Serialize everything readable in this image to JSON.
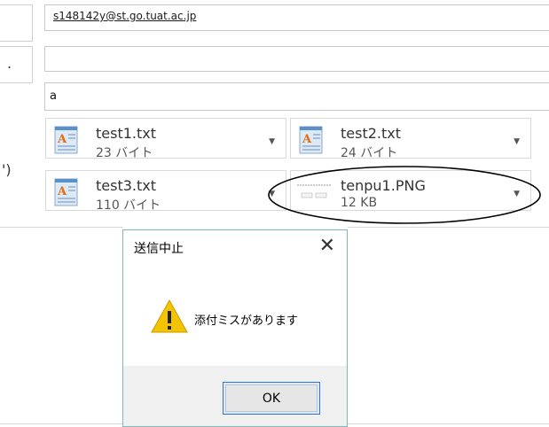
{
  "to_field": {
    "value": "s148142y@st.go.tuat.ac.jp"
  },
  "cc_field": {
    "value": ""
  },
  "subject_field": {
    "value": "a"
  },
  "side_fragments": {
    "row2": ".",
    "row4": "')"
  },
  "attachments": [
    {
      "name": "test1.txt",
      "size": "23 バイト",
      "icon": "text-document-icon"
    },
    {
      "name": "test2.txt",
      "size": "24 バイト",
      "icon": "text-document-icon"
    },
    {
      "name": "test3.txt",
      "size": "110 バイト",
      "icon": "text-document-icon"
    },
    {
      "name": "tenpu1.PNG",
      "size": "12 KB",
      "icon": "image-thumbnail-icon"
    }
  ],
  "dialog": {
    "title": "送信中止",
    "message": "添付ミスがあります",
    "ok_label": "OK",
    "close_glyph": "✕"
  },
  "colors": {
    "dialog_border": "#7fb8b6",
    "ok_border": "#2b79d6",
    "warning": "#f5c400"
  }
}
